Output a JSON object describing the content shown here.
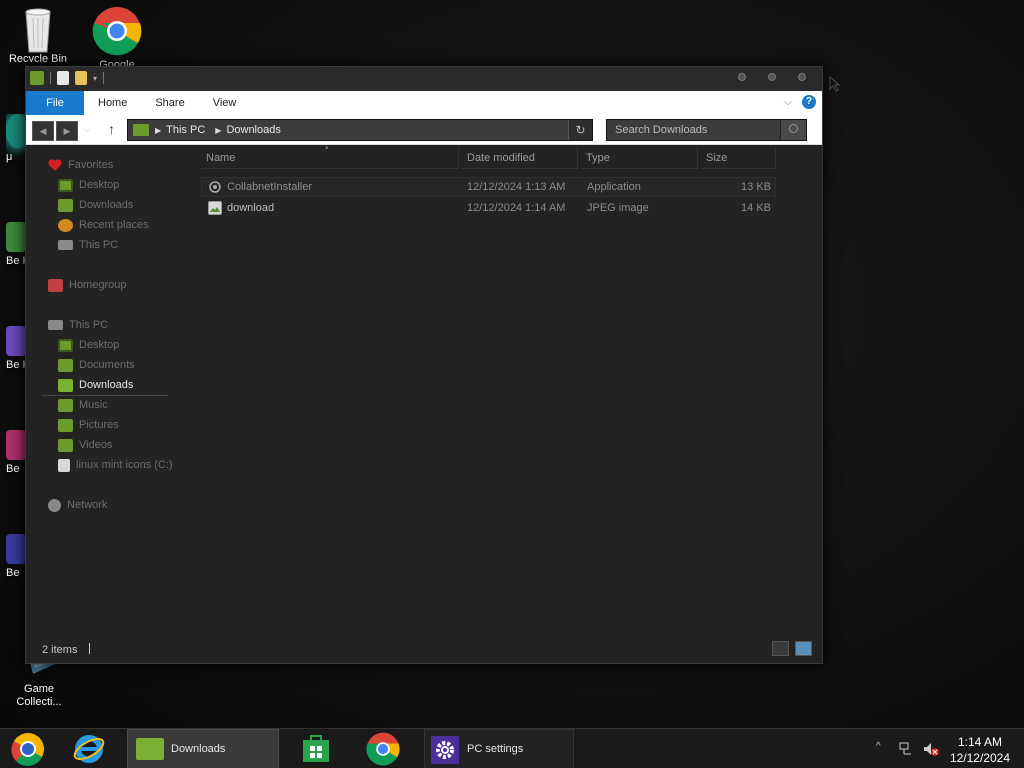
{
  "desktop": {
    "icons": [
      {
        "name": "recycle-bin",
        "label": "Recycle Bin"
      },
      {
        "name": "google-chrome",
        "label": "Google Chrome"
      },
      {
        "name": "game-collection",
        "label": "Game Collecti..."
      }
    ],
    "partial_labels": [
      "μ",
      "Be H",
      "Be H",
      "Be",
      "Be"
    ]
  },
  "window": {
    "ribbon": {
      "tabs": [
        "File",
        "Home",
        "Share",
        "View"
      ],
      "help": "?"
    },
    "address": {
      "crumbs": [
        "This PC",
        "Downloads"
      ],
      "search_placeholder": "Search Downloads"
    },
    "nav": {
      "favorites": "Favorites",
      "fav_items": [
        "Desktop",
        "Downloads",
        "Recent places",
        "This PC"
      ],
      "homegroup": "Homegroup",
      "thispc": "This PC",
      "pc_items": [
        "Desktop",
        "Documents",
        "Downloads",
        "Music",
        "Pictures",
        "Videos",
        "linux mint icons (C:)"
      ],
      "network": "Network",
      "selected": "Downloads"
    },
    "columns": [
      "Name",
      "Date modified",
      "Type",
      "Size"
    ],
    "files": [
      {
        "name": "CollabnetInstaller",
        "date": "12/12/2024 1:13 AM",
        "type": "Application",
        "size": "13 KB"
      },
      {
        "name": "download",
        "date": "12/12/2024 1:14 AM",
        "type": "JPEG image",
        "size": "14 KB"
      }
    ],
    "status": "2 items"
  },
  "taskbar": {
    "items": [
      {
        "name": "Downloads"
      },
      {
        "name": "PC settings"
      }
    ],
    "clock": {
      "time": "1:14 AM",
      "date": "12/12/2024"
    },
    "tray_caret": "^"
  }
}
